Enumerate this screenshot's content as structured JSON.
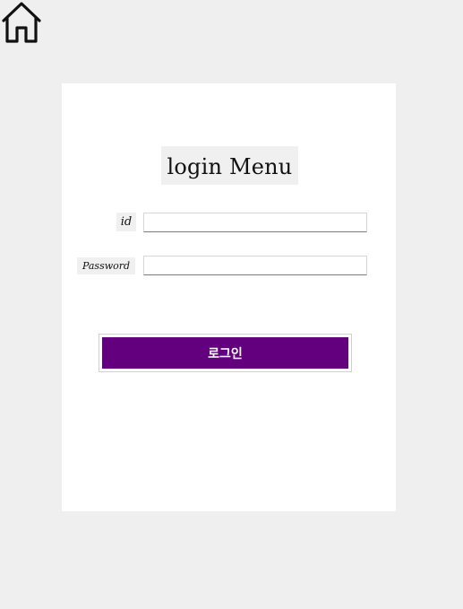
{
  "page": {
    "background_color": "#efefef",
    "accent_color": "#62007d"
  },
  "header": {
    "home_icon": "home-icon"
  },
  "login": {
    "title": "login Menu",
    "id_label": "id",
    "password_label": "Password",
    "id_value": "",
    "password_value": "",
    "submit_label": "로그인"
  }
}
